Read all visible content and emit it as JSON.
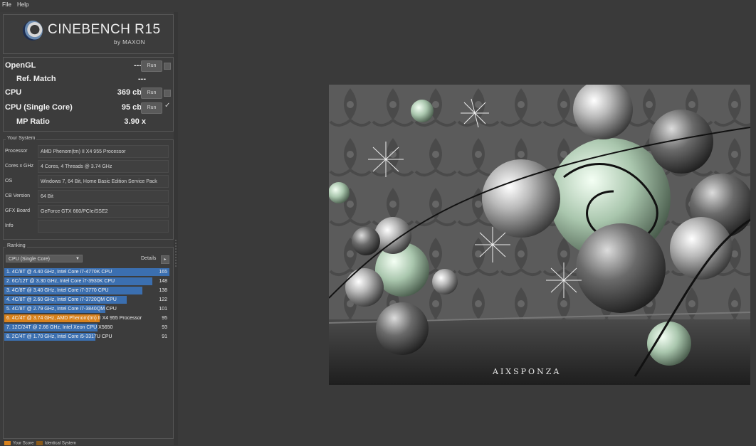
{
  "menu": [
    "File",
    "Help"
  ],
  "logo": {
    "title": "CINEBENCH R15",
    "subtitle": "by MAXON"
  },
  "scores": [
    {
      "label": "OpenGL",
      "value": "---",
      "button": "Run",
      "indent": false,
      "control": "checkbox"
    },
    {
      "label": "Ref. Match",
      "value": "---",
      "button": "",
      "indent": true,
      "control": ""
    },
    {
      "label": "CPU",
      "value": "369 cb",
      "button": "Run",
      "indent": false,
      "control": "checkbox"
    },
    {
      "label": "CPU (Single Core)",
      "value": "95 cb",
      "button": "Run",
      "indent": false,
      "control": "tick"
    },
    {
      "label": "MP Ratio",
      "value": "3.90 x",
      "button": "",
      "indent": true,
      "control": ""
    }
  ],
  "system": {
    "title": "Your System",
    "rows": [
      {
        "label": "Processor",
        "value": "AMD Phenom(tm) II X4 955 Processor"
      },
      {
        "label": "Cores x GHz",
        "value": "4 Cores, 4 Threads @ 3.74 GHz"
      },
      {
        "label": "OS",
        "value": "Windows 7, 64 Bit, Home Basic Edition Service Pack"
      },
      {
        "label": "CB Version",
        "value": "64 Bit"
      },
      {
        "label": "GFX Board",
        "value": "GeForce GTX 660/PCIe/SSE2"
      },
      {
        "label": "Info",
        "value": ""
      }
    ]
  },
  "ranking": {
    "title": "Ranking",
    "dropdown": "CPU (Single Core)",
    "details_label": "Details",
    "max_score": 165,
    "colors": {
      "other": "#3b6fb0",
      "yours": "#d9821c"
    },
    "items": [
      {
        "text": "1. 4C/8T @ 4.40 GHz, Intel Core i7-4770K CPU",
        "score": 165,
        "yours": false
      },
      {
        "text": "2. 6C/12T @ 3.30 GHz,  Intel Core i7-3930K CPU",
        "score": 148,
        "yours": false
      },
      {
        "text": "3. 4C/8T @ 3.40 GHz,  Intel Core i7-3770 CPU",
        "score": 138,
        "yours": false
      },
      {
        "text": "4. 4C/8T @ 2.60 GHz, Intel Core i7-3720QM CPU",
        "score": 122,
        "yours": false
      },
      {
        "text": "5. 4C/8T @ 2.79 GHz, Intel Core i7-3840QM CPU",
        "score": 101,
        "yours": false
      },
      {
        "text": "6. 4C/4T @ 3.74 GHz, AMD Phenom(tm) II X4 955 Processor",
        "score": 95,
        "yours": true
      },
      {
        "text": "7. 12C/24T @ 2.66 GHz, Intel Xeon CPU X5650",
        "score": 93,
        "yours": false
      },
      {
        "text": "8. 2C/4T @ 1.70 GHz,  Intel Core i5-3317U CPU",
        "score": 91,
        "yours": false
      }
    ]
  },
  "legend": {
    "your_score": "Your Score",
    "identical": "Identical System"
  },
  "render": {
    "watermark": "AIXSPONZA"
  }
}
